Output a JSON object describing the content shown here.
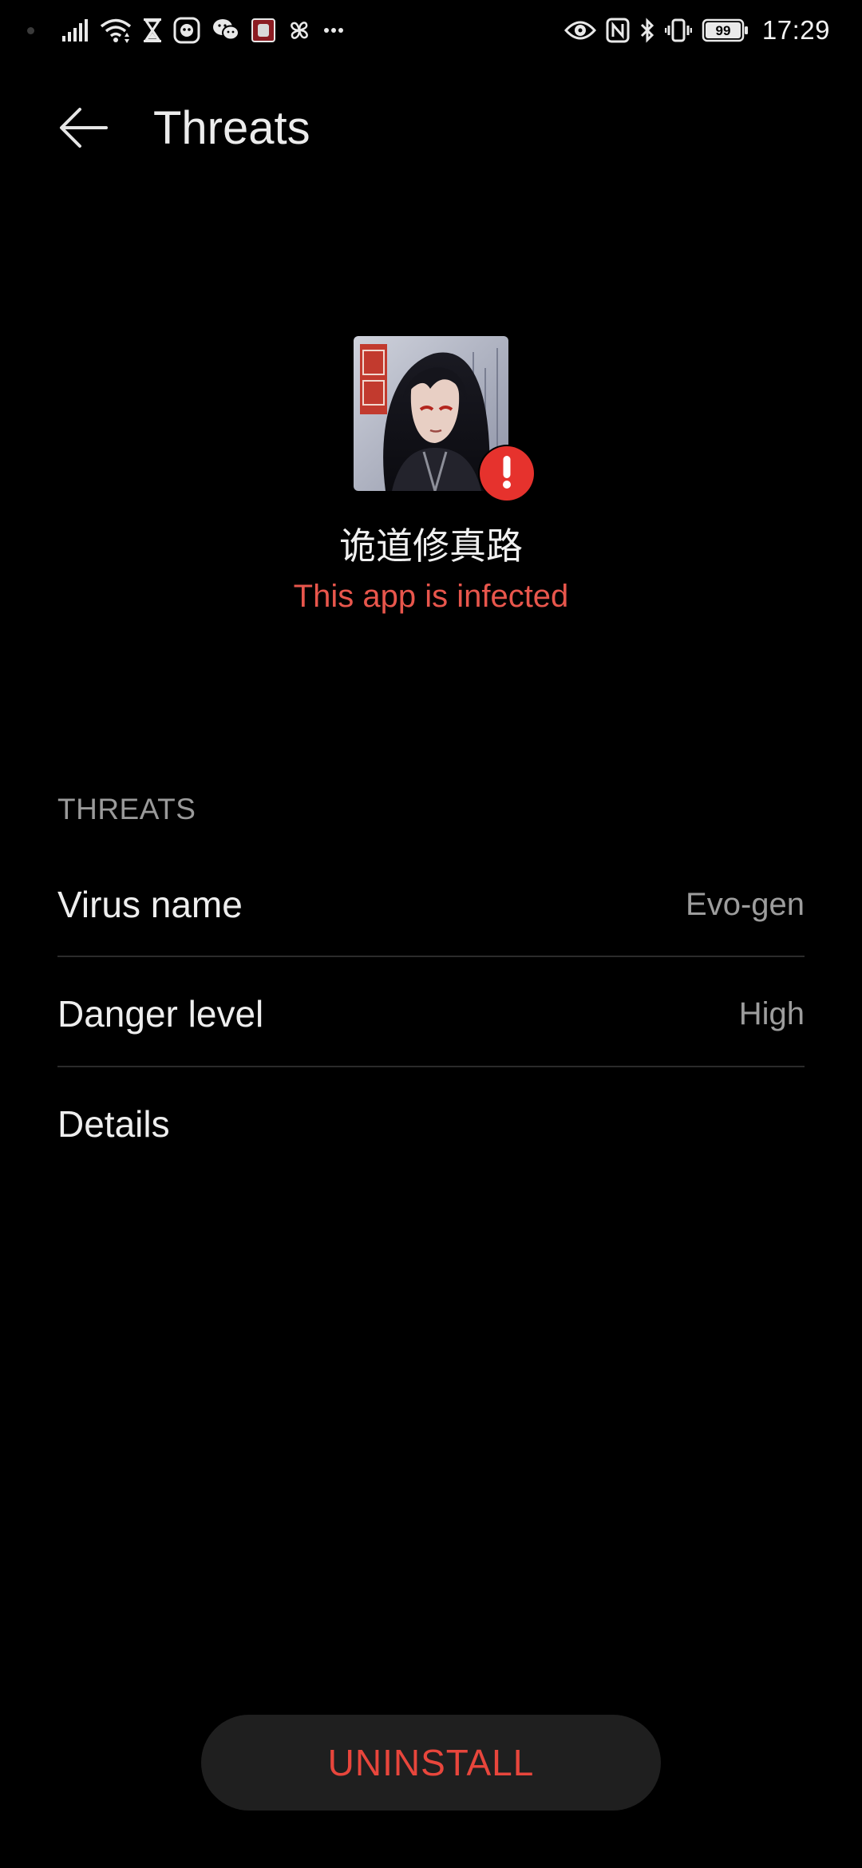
{
  "status_bar": {
    "time": "17:29",
    "battery_level": "99",
    "left_icons": [
      "signal-icon",
      "wifi-icon",
      "hourglass-icon",
      "app-notification-icon",
      "wechat-icon",
      "app-thumbnail-icon",
      "pinwheel-icon",
      "more-notifications-icon"
    ],
    "right_icons": [
      "eye-comfort-icon",
      "nfc-icon",
      "bluetooth-icon",
      "vibrate-icon",
      "battery-icon"
    ]
  },
  "app_bar": {
    "title": "Threats",
    "back_icon": "arrow-left-icon"
  },
  "app_info": {
    "name": "诡道修真路",
    "status": "This app is infected",
    "badge_icon": "exclamation-icon"
  },
  "threats": {
    "section_header": "THREATS",
    "rows": [
      {
        "label": "Virus name",
        "value": "Evo-gen"
      },
      {
        "label": "Danger level",
        "value": "High"
      },
      {
        "label": "Details",
        "value": ""
      }
    ]
  },
  "actions": {
    "uninstall_label": "UNINSTALL"
  },
  "colors": {
    "background": "#000000",
    "accent_red": "#e8463c",
    "badge_red": "#e6322d",
    "button_bg": "#1f1f1f"
  }
}
